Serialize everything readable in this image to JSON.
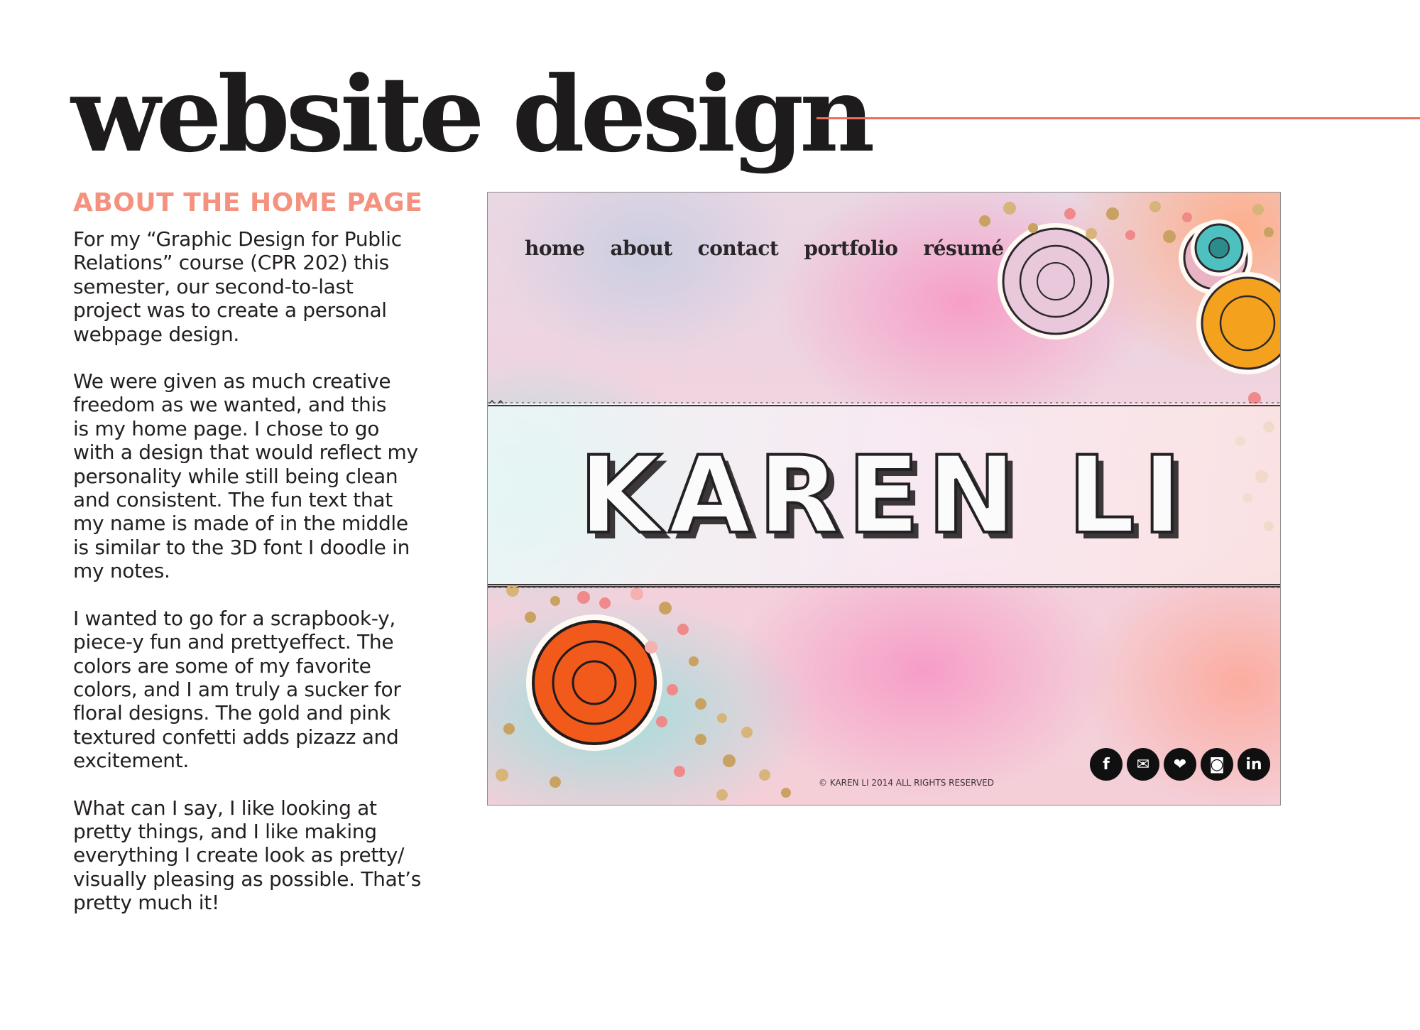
{
  "page": {
    "title": "website  design",
    "section_heading": "ABOUT THE HOME PAGE",
    "paragraphs": [
      "For my “Graphic Design for Public\nRelations” course (CPR 202) this\nsemester, our second-to-last\nproject was to create a personal\nwebpage design.",
      "We were given as much creative\nfreedom as we wanted, and this\nis my home page. I chose to go\nwith a design that would reflect my\npersonality while still being clean\nand consistent. The fun text that\nmy name is made of in the middle\nis similar to the 3D font I doodle in\nmy notes.",
      "I wanted to go for a scrapbook-y,\npiece-y fun and prettyeffect. The\ncolors are some of my favorite\ncolors, and I am truly a sucker for\nfloral designs. The gold and pink\ntextured confetti  adds pizazz and\nexcitement.",
      "What can I say, I like looking at\npretty things, and I like making\neverything I create look as pretty/\nvisually pleasing as possible. That’s\npretty much it!"
    ]
  },
  "mockup": {
    "nav": [
      "home",
      "about",
      "contact",
      "portfolio",
      "résumé"
    ],
    "name": "KAREN LI",
    "copyright": "© KAREN LI 2014 ALL RIGHTS RESERVED",
    "social_icons": [
      {
        "icon": "facebook-icon",
        "glyph": "f"
      },
      {
        "icon": "email-icon",
        "glyph": "✉"
      },
      {
        "icon": "twitter-icon",
        "glyph": "❤"
      },
      {
        "icon": "instagram-icon",
        "glyph": "◙"
      },
      {
        "icon": "linkedin-icon",
        "glyph": "in"
      }
    ]
  },
  "colors": {
    "accent_rule": "#ec6c5e",
    "heading": "#f4927f",
    "title": "#1e1b1c"
  }
}
